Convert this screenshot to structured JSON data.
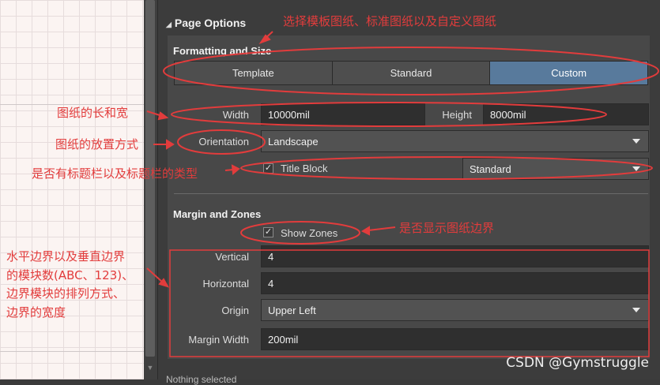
{
  "panel": {
    "header": "Page Options",
    "formatting": {
      "title": "Formatting and Size",
      "options": [
        "Template",
        "Standard",
        "Custom"
      ],
      "selected": "Custom"
    },
    "width_label": "Width",
    "width_value": "10000mil",
    "height_label": "Height",
    "height_value": "8000mil",
    "orientation_label": "Orientation",
    "orientation_value": "Landscape",
    "title_block_label": "Title Block",
    "title_block_checked": true,
    "title_block_value": "Standard",
    "margin": {
      "title": "Margin and Zones",
      "show_zones_label": "Show Zones",
      "show_zones_checked": true,
      "vertical_label": "Vertical",
      "vertical_value": "4",
      "horizontal_label": "Horizontal",
      "horizontal_value": "4",
      "origin_label": "Origin",
      "origin_value": "Upper Left",
      "margin_width_label": "Margin Width",
      "margin_width_value": "200mil"
    },
    "footer": "Nothing selected"
  },
  "annotations": {
    "template_note": "选择模板图纸、标准图纸以及自定义图纸",
    "size_note": "图纸的长和宽",
    "orientation_note": "图纸的放置方式",
    "title_block_note": "是否有标题栏以及标题栏的类型",
    "zones_note": "是否显示图纸边界",
    "margin_note_1": "水平边界以及垂直边界",
    "margin_note_2": "的模块数(ABC、123)、",
    "margin_note_3": "边界模块的排列方式、",
    "margin_note_4": "边界的宽度"
  },
  "watermark": "CSDN @Gymstruggle",
  "colors": {
    "annotation": "#e23c3c",
    "selected_segment": "#587a9c",
    "panel_bg": "#3c3c3c"
  }
}
